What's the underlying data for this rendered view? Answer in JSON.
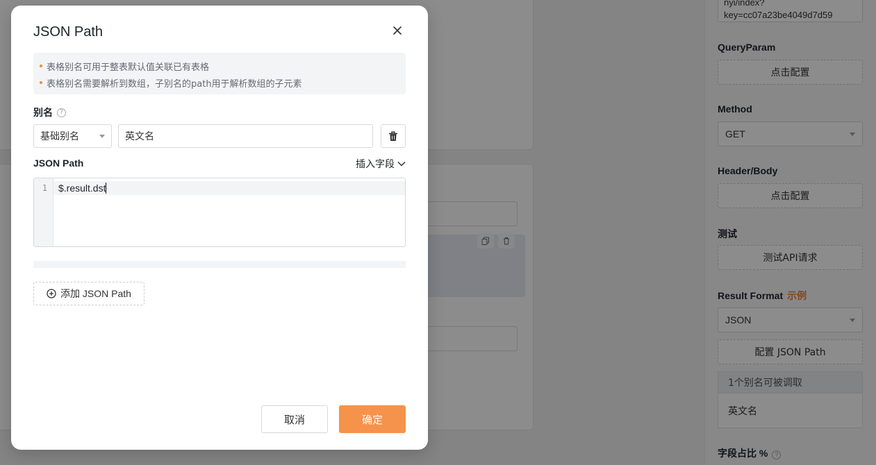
{
  "modal": {
    "title": "JSON Path",
    "notice": [
      "表格别名可用于整表默认值关联已有表格",
      "表格别名需要解析到数组，子别名的path用于解析数组的子元素"
    ],
    "alias_label": "别名",
    "alias_type_selected": "基础别名",
    "alias_input_value": "英文名",
    "json_path_label": "JSON Path",
    "insert_field_label": "插入字段",
    "editor": {
      "line_numbers": [
        "1"
      ],
      "lines": [
        "$.result.dst"
      ]
    },
    "add_json_path_label": "添加 JSON Path",
    "cancel_label": "取消",
    "confirm_label": "确定"
  },
  "right_panel": {
    "url_text": "nyi/index?key=cc07a23be4049d7d59",
    "query_param_label": "QueryParam",
    "query_param_button": "点击配置",
    "method_label": "Method",
    "method_value": "GET",
    "header_body_label": "Header/Body",
    "header_body_button": "点击配置",
    "test_label": "测试",
    "test_button": "测试API请求",
    "result_format_label": "Result Format",
    "result_format_example": "示例",
    "result_format_value": "JSON",
    "config_json_path_button": "配置 JSON Path",
    "alias_count_text": "1个别名可被调取",
    "alias_item": "英文名",
    "field_ratio_label": "字段占比 %"
  },
  "colors": {
    "primary": "#f5924b",
    "accent_text": "#e8833a",
    "notice_dot": "#f08a3c"
  },
  "icons": {
    "close": "close-icon",
    "help": "question-circle-icon",
    "dropdown": "caret-down-icon",
    "delete": "trash-icon",
    "chevron": "chevron-down-icon",
    "add": "plus-circle-icon",
    "copy": "copy-icon"
  }
}
